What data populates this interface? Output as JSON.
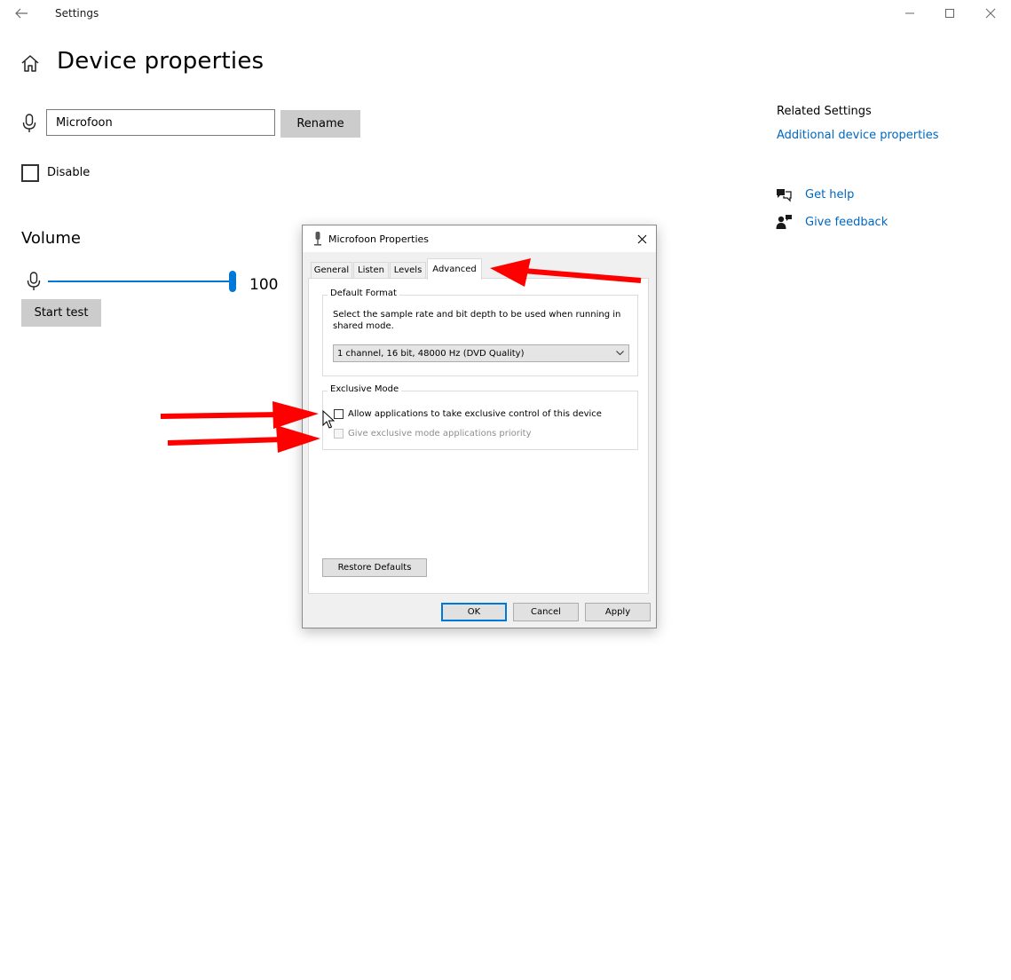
{
  "window": {
    "title": "Settings",
    "back_icon": "back-arrow-icon",
    "controls": [
      "minimize-icon",
      "maximize-icon",
      "close-icon"
    ]
  },
  "page": {
    "title": "Device properties",
    "home_icon": "home-icon"
  },
  "device": {
    "name_value": "Microfoon",
    "rename_label": "Rename",
    "disable_label": "Disable",
    "disable_checked": false
  },
  "volume": {
    "heading": "Volume",
    "value": "100",
    "level_percent": 100,
    "start_test_label": "Start test"
  },
  "related": {
    "title": "Related Settings",
    "additional_link": "Additional device properties",
    "get_help": "Get help",
    "give_feedback": "Give feedback"
  },
  "dialog": {
    "title": "Microfoon Properties",
    "tabs": [
      {
        "label": "General",
        "active": false
      },
      {
        "label": "Listen",
        "active": false
      },
      {
        "label": "Levels",
        "active": false
      },
      {
        "label": "Advanced",
        "active": true
      }
    ],
    "default_format": {
      "group_label": "Default Format",
      "description": "Select the sample rate and bit depth to be used when running in shared mode.",
      "selected": "1 channel, 16 bit, 48000 Hz (DVD Quality)"
    },
    "exclusive_mode": {
      "group_label": "Exclusive Mode",
      "allow_label": "Allow applications to take exclusive control of this device",
      "allow_checked": false,
      "priority_label": "Give exclusive mode applications priority",
      "priority_checked": false,
      "priority_disabled": true
    },
    "restore_defaults": "Restore Defaults",
    "ok": "OK",
    "cancel": "Cancel",
    "apply": "Apply"
  },
  "colors": {
    "accent": "#0078d7",
    "link": "#0067c0",
    "annotation_arrow": "#ff0000"
  }
}
